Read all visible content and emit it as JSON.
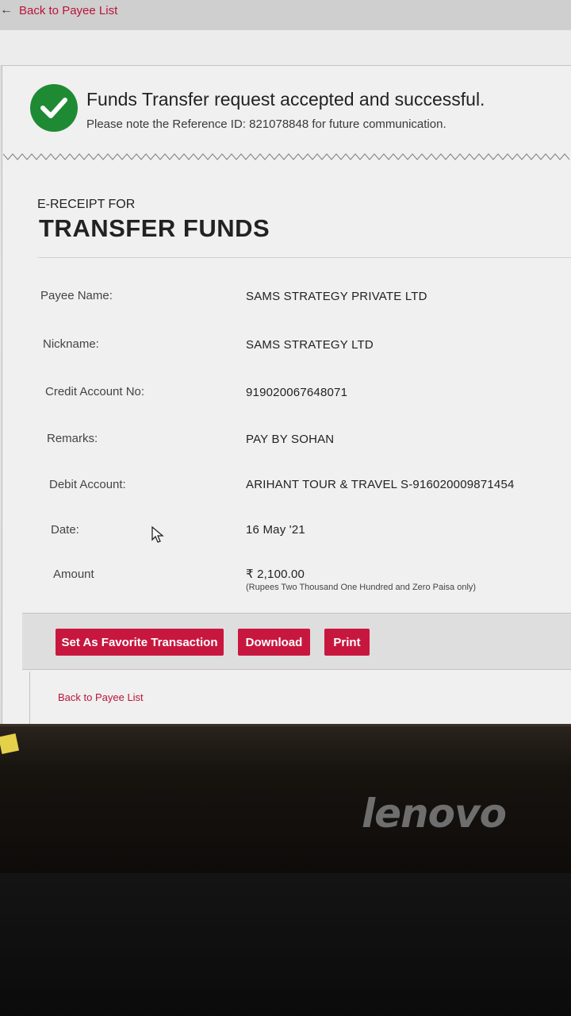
{
  "nav": {
    "back_to_payee_list": "Back to Payee List"
  },
  "success": {
    "title": "Funds Transfer request accepted and successful.",
    "note": "Please note the Reference ID: 821078848 for future communication."
  },
  "receipt": {
    "heading_small": "E-RECEIPT FOR",
    "heading_large": "TRANSFER FUNDS",
    "rows": [
      {
        "label": "Payee Name:",
        "value": "SAMS STRATEGY PRIVATE LTD"
      },
      {
        "label": "Nickname:",
        "value": "SAMS STRATEGY LTD"
      },
      {
        "label": "Credit Account No:",
        "value": "919020067648071"
      },
      {
        "label": "Remarks:",
        "value": "PAY BY SOHAN"
      },
      {
        "label": "Debit Account:",
        "value": "ARIHANT TOUR & TRAVEL S-916020009871454"
      },
      {
        "label": "Date:",
        "value": "16 May '21"
      },
      {
        "label": "Amount",
        "value": "₹ 2,100.00"
      }
    ],
    "amount_words": "(Rupees Two Thousand One Hundred and Zero Paisa only)"
  },
  "buttons": {
    "favorite": "Set As Favorite Transaction",
    "download": "Download",
    "print": "Print"
  },
  "footer": {
    "back_to_payee_list": "Back to Payee List"
  },
  "monitor": {
    "brand": "lenovo"
  },
  "colors": {
    "accent": "#c8173f",
    "success_green": "#1f8a34",
    "link": "#b8143a"
  }
}
